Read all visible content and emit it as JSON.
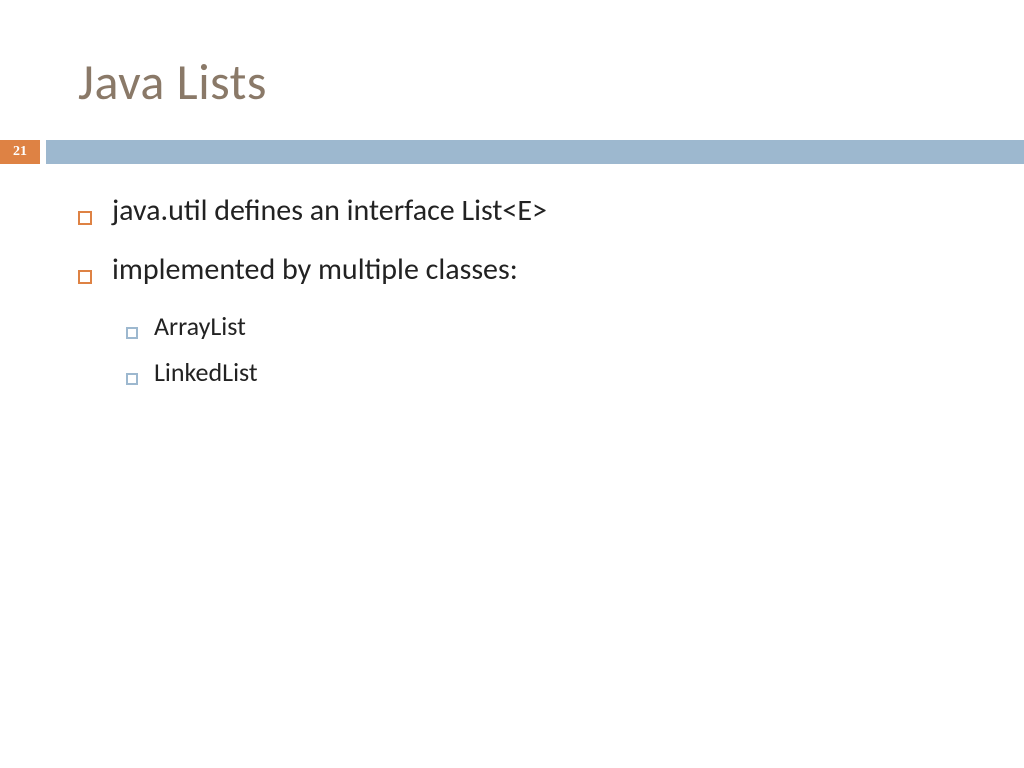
{
  "slide": {
    "title": "Java Lists",
    "page_number": "21",
    "bullets": [
      {
        "level": 1,
        "text": "java.util defines an interface List<E>"
      },
      {
        "level": 1,
        "text": "implemented by multiple classes:"
      },
      {
        "level": 2,
        "text": "ArrayList"
      },
      {
        "level": 2,
        "text": "LinkedList"
      }
    ]
  },
  "colors": {
    "title": "#8a7968",
    "accent_orange": "#de8244",
    "accent_blue": "#9db8cf"
  }
}
